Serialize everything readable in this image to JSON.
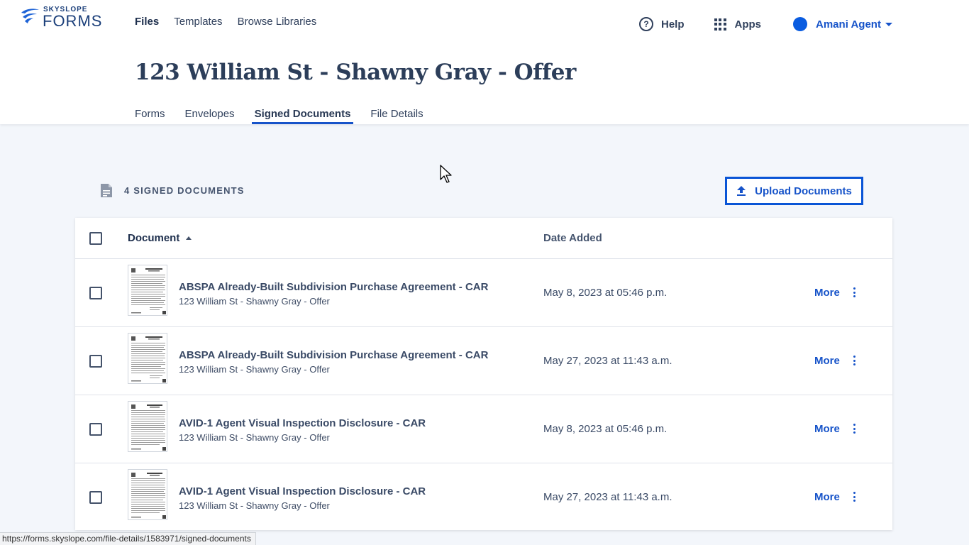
{
  "logo": {
    "small": "SKYSLOPE",
    "big": "FORMS"
  },
  "topnav": [
    "Files",
    "Templates",
    "Browse Libraries"
  ],
  "rightnav": {
    "help": "Help",
    "help_glyph": "?",
    "apps": "Apps",
    "user": "Amani Agent"
  },
  "page_title": "123 William St - Shawny Gray - Offer",
  "tabs": [
    "Forms",
    "Envelopes",
    "Signed Documents",
    "File Details"
  ],
  "active_tab": "Signed Documents",
  "section_title": "4 SIGNED DOCUMENTS",
  "upload_label": "Upload Documents",
  "table": {
    "col_document": "Document",
    "col_date": "Date Added",
    "rows": [
      {
        "name": "ABSPA Already-Built Subdivision Purchase Agreement - CAR",
        "file": "123 William St - Shawny Gray - Offer",
        "date": "May 8, 2023 at 05:46 p.m.",
        "action": "More"
      },
      {
        "name": "ABSPA Already-Built Subdivision Purchase Agreement - CAR",
        "file": "123 William St - Shawny Gray - Offer",
        "date": "May 27, 2023 at 11:43 a.m.",
        "action": "More"
      },
      {
        "name": "AVID-1 Agent Visual Inspection Disclosure - CAR",
        "file": "123 William St - Shawny Gray - Offer",
        "date": "May 8, 2023 at 05:46 p.m.",
        "action": "More"
      },
      {
        "name": "AVID-1 Agent Visual Inspection Disclosure - CAR",
        "file": "123 William St - Shawny Gray - Offer",
        "date": "May 27, 2023 at 11:43 a.m.",
        "action": "More"
      }
    ]
  },
  "status_url": "https://forms.skyslope.com/file-details/1583971/signed-documents",
  "colors": {
    "accent": "#1653c9",
    "text": "#30405c",
    "background": "#f3f6fb"
  }
}
